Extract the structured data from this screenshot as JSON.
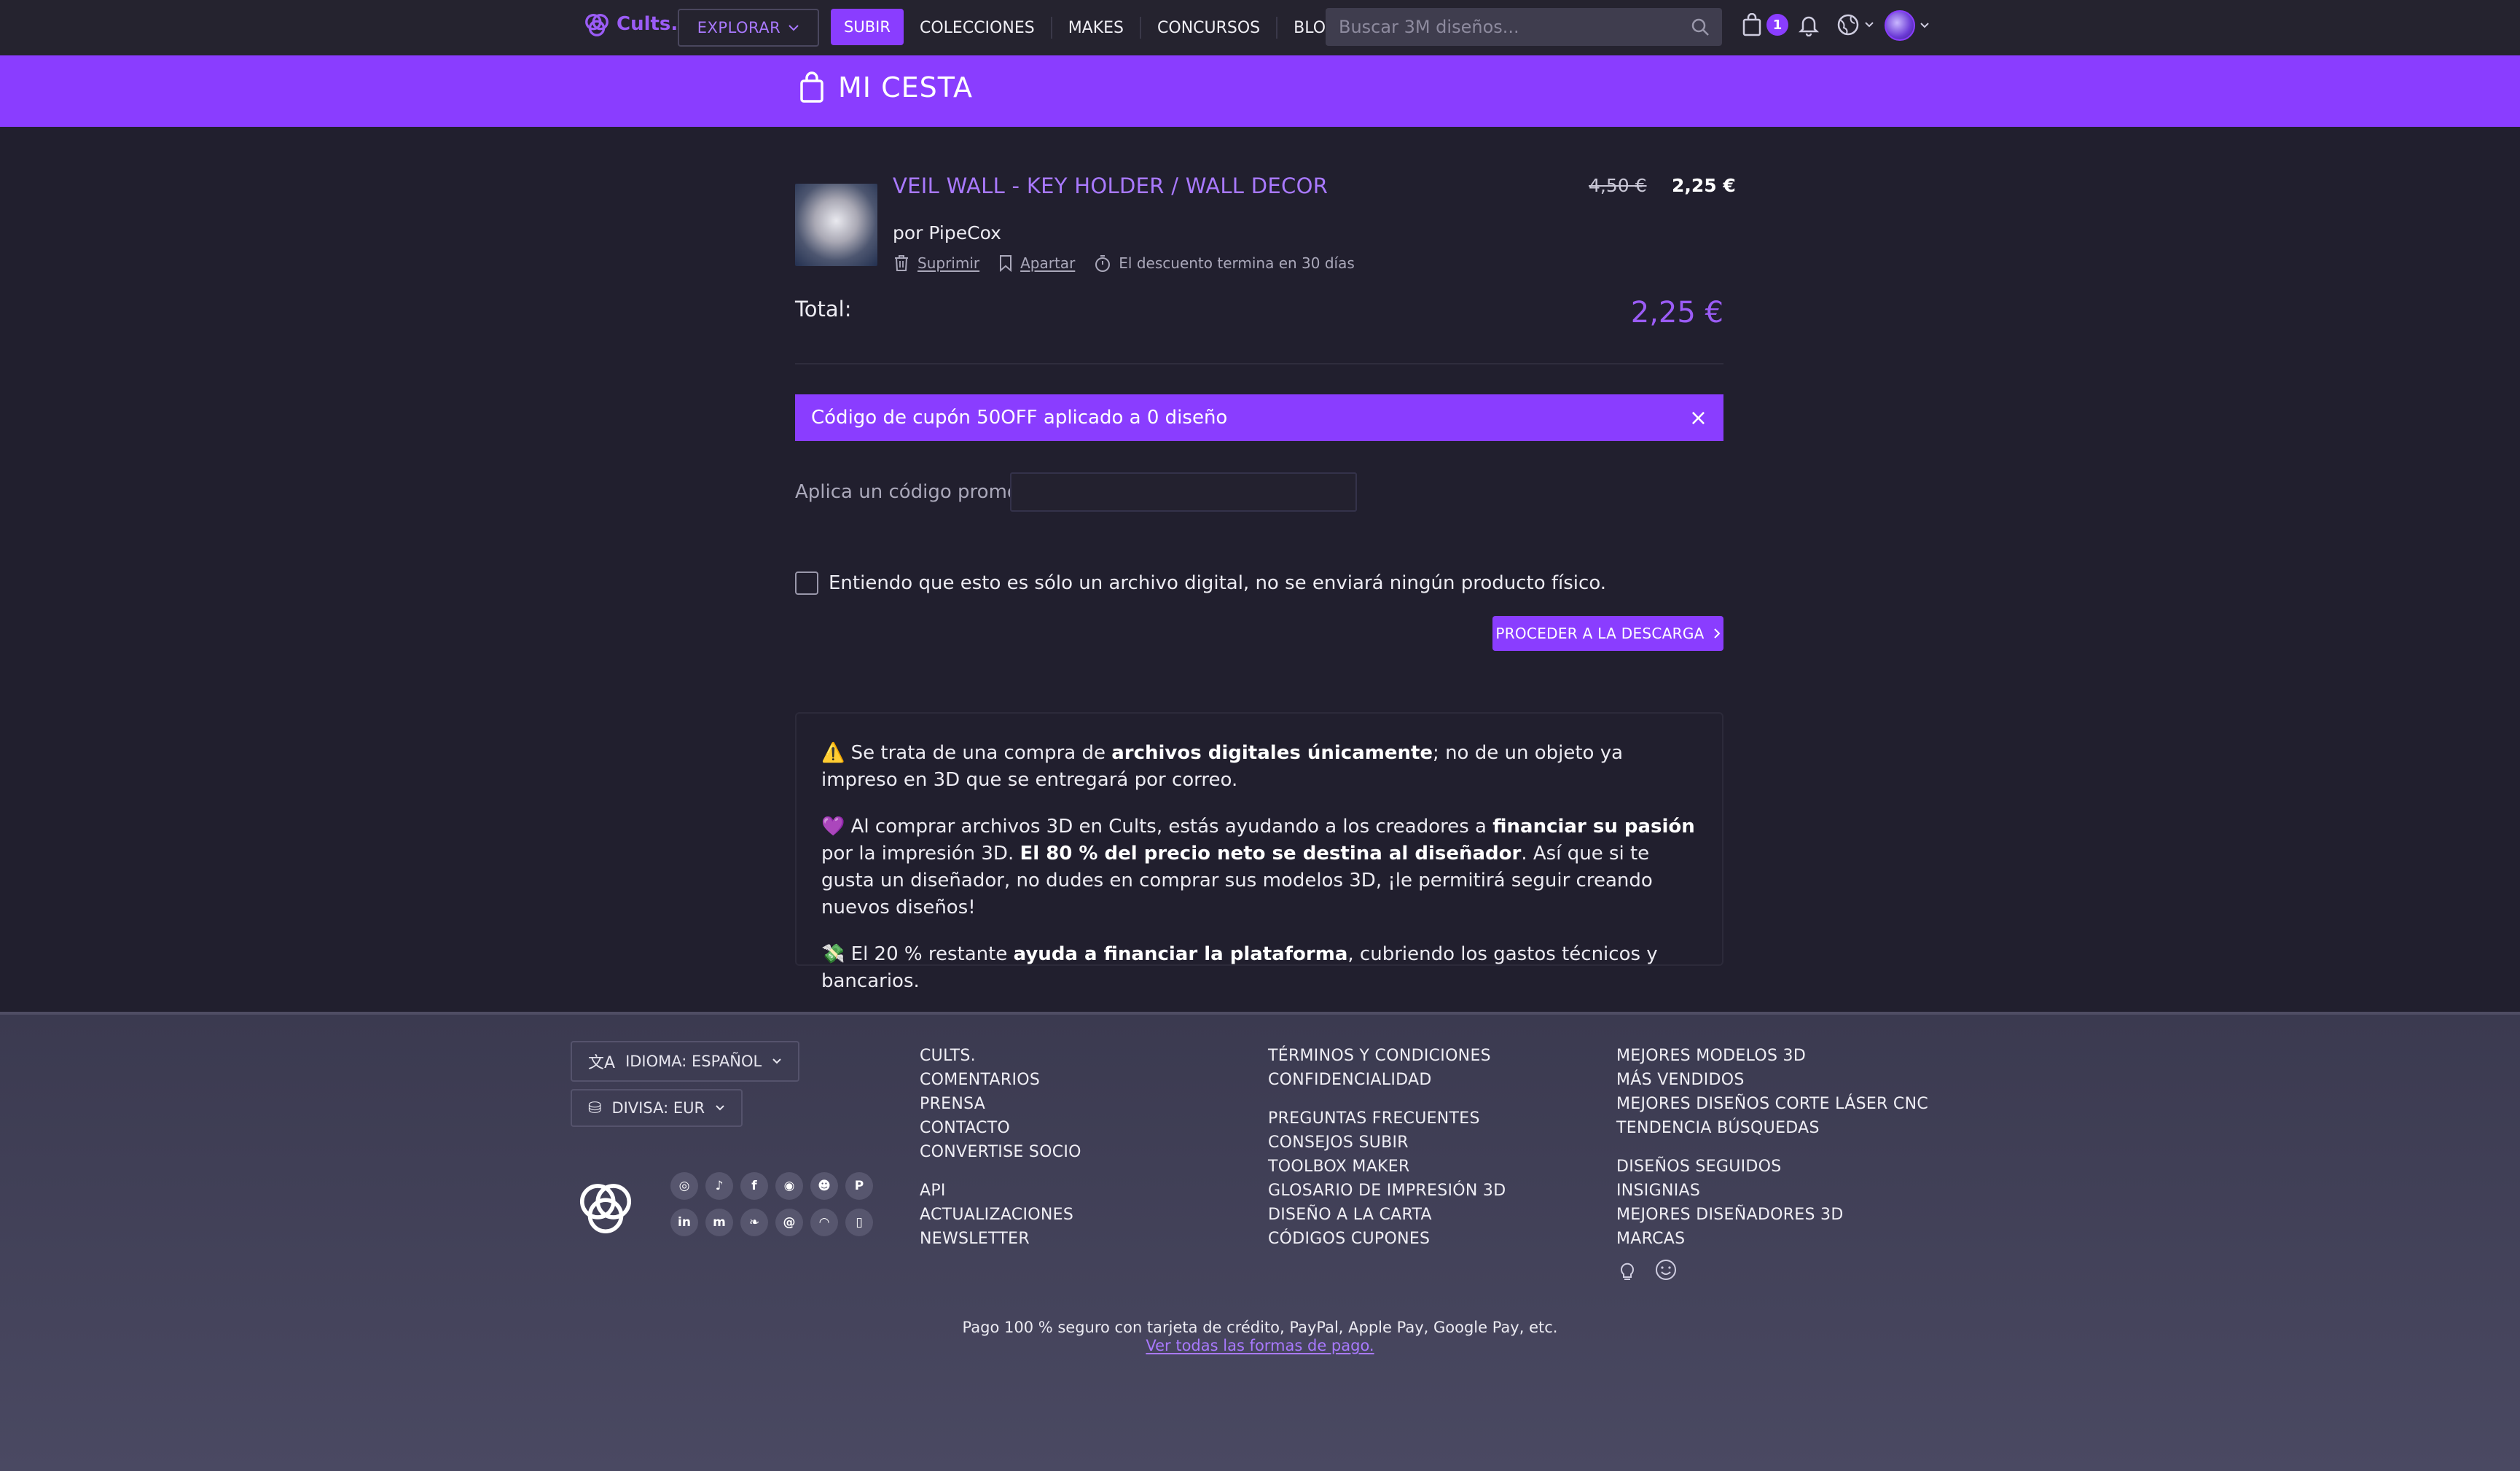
{
  "nav": {
    "logo_text": "Cults.",
    "explore_label": "EXPLORAR",
    "upload_label": "SUBIR",
    "links": [
      "COLECCIONES",
      "MAKES",
      "CONCURSOS",
      "BLOG"
    ],
    "search_placeholder": "Buscar 3M diseños...",
    "cart_count": "1"
  },
  "header": {
    "title": "MI CESTA"
  },
  "cart": {
    "item": {
      "title": "VEIL WALL - KEY HOLDER / WALL DECOR",
      "old_price": "4,50 €",
      "new_price": "2,25 €",
      "author": "por PipeCox",
      "delete_label": "Suprimir",
      "save_label": "Apartar",
      "discount_note": "El descuento termina en 30 días"
    },
    "total_label": "Total:",
    "total_value": "2,25 €"
  },
  "coupon": {
    "message": "Código de cupón 50OFF aplicado a 0 diseño",
    "close": "×"
  },
  "promo": {
    "label": "Aplica un código promo:",
    "value": ""
  },
  "confirm": {
    "label": "Entiendo que esto es sólo un archivo digital, no se enviará ningún producto físico."
  },
  "proceed_label": "PROCEDER A LA DESCARGA",
  "info": {
    "p1_pre": "Se trata de una compra de ",
    "p1_bold": "archivos digitales únicamente",
    "p1_post": "; no de un objeto ya impreso en 3D que se entregará por correo.",
    "p2_pre": "Al comprar archivos 3D en Cults, estás ayudando a los creadores a ",
    "p2_bold1": "financiar su pasión",
    "p2_mid": " por la impresión 3D. ",
    "p2_bold2": "El 80 % del precio neto se destina al diseñador",
    "p2_post": ". Así que si te gusta un diseñador, no dudes en comprar sus modelos 3D, ¡le permitirá seguir creando nuevos diseños!",
    "p3_pre": "El 20 % restante ",
    "p3_bold": "ayuda a financiar la plataforma",
    "p3_post": ", cubriendo los gastos técnicos y bancarios."
  },
  "footer": {
    "language_label": "IDIOMA: ESPAÑOL",
    "currency_label": "DIVISA: EUR",
    "col1": [
      "CULTS.",
      "COMENTARIOS",
      "PRENSA",
      "CONTACTO",
      "CONVERTISE SOCIO"
    ],
    "col1b": [
      "API",
      "ACTUALIZACIONES",
      "NEWSLETTER"
    ],
    "col2": [
      "TÉRMINOS Y CONDICIONES",
      "CONFIDENCIALIDAD"
    ],
    "col2b": [
      "PREGUNTAS FRECUENTES",
      "CONSEJOS SUBIR",
      "TOOLBOX MAKER",
      "GLOSARIO DE IMPRESIÓN 3D",
      "DISEÑO A LA CARTA",
      "CÓDIGOS CUPONES"
    ],
    "col3": [
      "MEJORES MODELOS 3D",
      "MÁS VENDIDOS",
      "MEJORES DISEÑOS CORTE LÁSER CNC",
      "TENDENCIA BÚSQUEDAS"
    ],
    "col3b": [
      "DISEÑOS SEGUIDOS",
      "INSIGNIAS",
      "MEJORES DISEÑADORES 3D",
      "MARCAS"
    ],
    "payment_note": "Pago 100 % seguro con tarjeta de crédito, PayPal, Apple Pay, Google Pay, etc.",
    "payment_link": "Ver todas las formas de pago.",
    "social": [
      "instagram-icon",
      "tiktok-icon",
      "facebook-icon",
      "reddit-icon",
      "discord-icon",
      "pinterest-icon",
      "linkedin-icon",
      "mastodon-icon",
      "bluesky-icon",
      "threads-icon",
      "rss-icon",
      "mobile-app-icon"
    ]
  },
  "colors": {
    "accent": "#8a3dff",
    "link": "#a979ff",
    "background": "#211f2e"
  }
}
